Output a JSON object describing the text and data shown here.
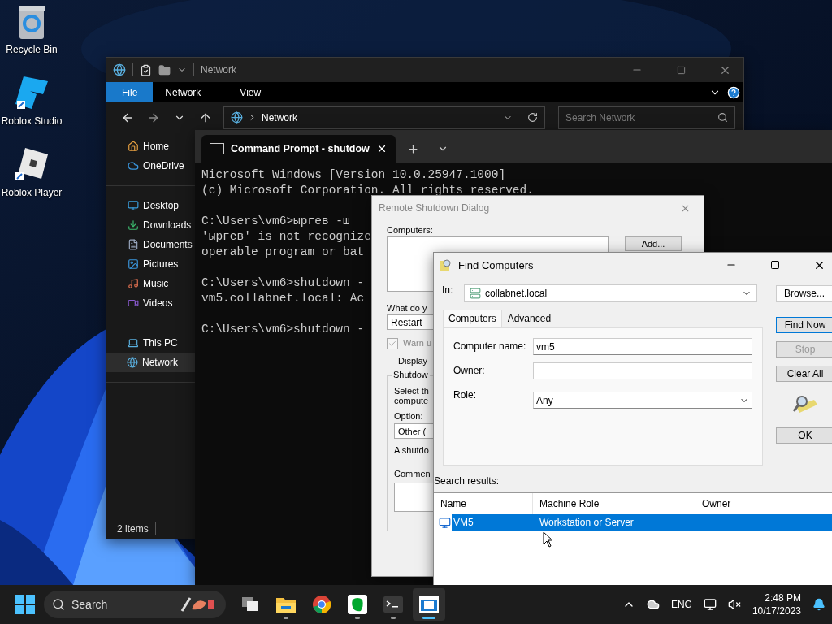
{
  "desktop_icons": [
    {
      "label": "Recycle Bin",
      "kind": "bin"
    },
    {
      "label": "Roblox Studio",
      "kind": "studio"
    },
    {
      "label": "Roblox Player",
      "kind": "player"
    }
  ],
  "explorer": {
    "title": "Network",
    "ribbon_tabs": [
      {
        "label": "File",
        "selected": true
      },
      {
        "label": "Network",
        "selected": false
      },
      {
        "label": "View",
        "selected": false
      }
    ],
    "address": "Network",
    "search": {
      "placeholder": "Search Network"
    },
    "sidebar": [
      {
        "items": [
          {
            "label": "Home",
            "kind": "home",
            "selected": false
          },
          {
            "label": "OneDrive",
            "kind": "cloud",
            "selected": false
          }
        ]
      },
      {
        "items": [
          {
            "label": "Desktop",
            "kind": "desktop",
            "selected": false
          },
          {
            "label": "Downloads",
            "kind": "downloads",
            "selected": false
          },
          {
            "label": "Documents",
            "kind": "documents",
            "selected": false
          },
          {
            "label": "Pictures",
            "kind": "pictures",
            "selected": false
          },
          {
            "label": "Music",
            "kind": "music",
            "selected": false
          },
          {
            "label": "Videos",
            "kind": "videos",
            "selected": false
          }
        ]
      },
      {
        "items": [
          {
            "label": "This PC",
            "kind": "pc",
            "selected": false
          },
          {
            "label": "Network",
            "kind": "network",
            "selected": true
          }
        ]
      }
    ],
    "status": "2 items"
  },
  "terminal": {
    "tab_title": "Command Prompt - shutdow",
    "blocks": [
      [
        "Microsoft Windows [Version 10.0.25947.1000]",
        "(c) Microsoft Corporation. All rights reserved."
      ],
      [
        "C:\\Users\\vm6>ыргев -ш",
        "'ыргев' is not recognize",
        "operable program or bat"
      ],
      [
        "C:\\Users\\vm6>shutdown -",
        "vm5.collabnet.local: Ac"
      ],
      [
        "C:\\Users\\vm6>shutdown -"
      ]
    ]
  },
  "remote_shutdown": {
    "title": "Remote Shutdown Dialog",
    "computers_label": "Computers:",
    "add_button": "Add...",
    "action_label": "What do y",
    "action_value": "Restart",
    "warn": {
      "label": "Warn u",
      "checked": true,
      "disabled": true
    },
    "display_label": "Display",
    "group_title": "Shutdow",
    "group_text": [
      "Select th",
      "compute"
    ],
    "option_label": "Option:",
    "option_value": "Other (",
    "note": "A shutdo",
    "comment_label": "Commen"
  },
  "find_computers": {
    "title": "Find Computers",
    "in_label": "In:",
    "in_value": "collabnet.local",
    "browse_button": "Browse...",
    "tabs": [
      {
        "label": "Computers",
        "selected": true
      },
      {
        "label": "Advanced",
        "selected": false
      }
    ],
    "fields": [
      {
        "label": "Computer name:",
        "value": "vm5",
        "kind": "text"
      },
      {
        "label": "Owner:",
        "kind": "text"
      },
      {
        "label": "Role:",
        "value": "Any",
        "kind": "select"
      }
    ],
    "buttons": [
      {
        "label": "Find Now",
        "kind": "default",
        "disabled": false
      },
      {
        "label": "Stop",
        "kind": "normal",
        "disabled": true
      },
      {
        "label": "Clear All",
        "kind": "normal",
        "disabled": false
      },
      {
        "kind": "art"
      },
      {
        "label": "OK",
        "kind": "normal",
        "disabled": false
      }
    ],
    "results_label": "Search results:",
    "table": {
      "columns": [
        "Name",
        "Machine Role",
        "Owner"
      ],
      "rows": [
        {
          "cells": [
            "VM5",
            "Workstation or Server"
          ],
          "selected": true
        }
      ]
    }
  },
  "taskbar": {
    "search_placeholder": "Search",
    "apps": [
      {
        "kind": "taskview",
        "running": false,
        "active": false
      },
      {
        "kind": "explorer",
        "running": true,
        "active": false
      },
      {
        "kind": "chrome",
        "running": false,
        "active": false
      },
      {
        "kind": "evernote",
        "running": true,
        "active": false
      },
      {
        "kind": "terminal",
        "running": true,
        "active": false
      },
      {
        "kind": "window",
        "running": true,
        "active": true
      }
    ],
    "language": "ENG",
    "time": "2:48 PM",
    "date": "10/17/2023"
  }
}
